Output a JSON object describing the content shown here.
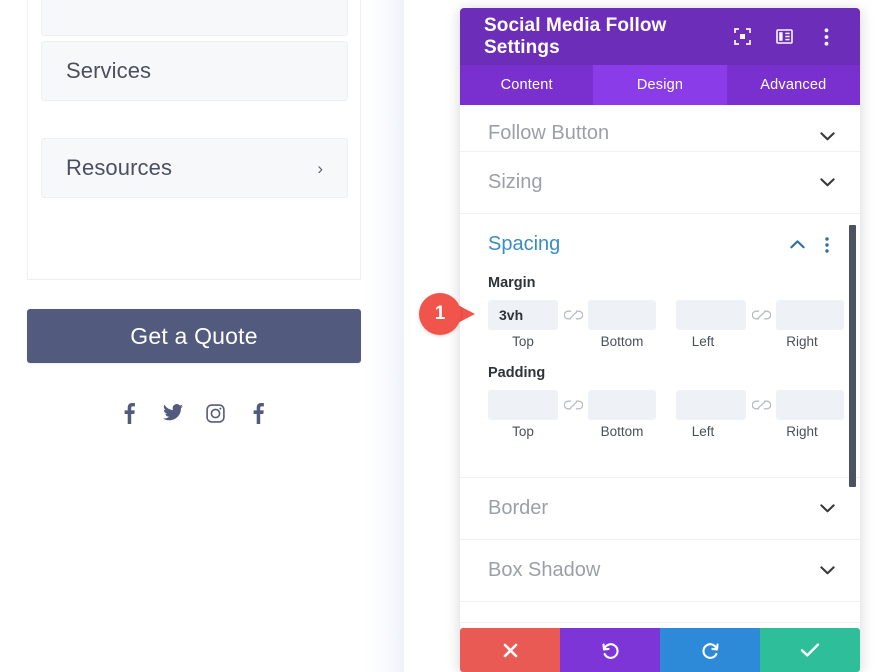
{
  "preview": {
    "menu_items": [
      {
        "label": "",
        "has_chevron": false
      },
      {
        "label": "Services",
        "has_chevron": false
      },
      {
        "label": "Resources",
        "has_chevron": true,
        "chevron": "›"
      }
    ],
    "cta_button": {
      "label": "Get a Quote",
      "color": "#525b7e"
    },
    "social_icons": [
      {
        "name": "facebook-icon",
        "label": "Facebook"
      },
      {
        "name": "twitter-icon",
        "label": "Twitter"
      },
      {
        "name": "instagram-icon",
        "label": "Instagram"
      },
      {
        "name": "facebook-icon",
        "label": "Facebook"
      }
    ]
  },
  "modal": {
    "title": "Social Media Follow Settings",
    "header_color": "#6c2eb9",
    "header_icons": [
      {
        "name": "focus-target-icon"
      },
      {
        "name": "layout-columns-icon"
      },
      {
        "name": "more-vertical-icon"
      }
    ],
    "tabs": [
      {
        "label": "Content",
        "active": false
      },
      {
        "label": "Design",
        "active": true
      },
      {
        "label": "Advanced",
        "active": false
      }
    ],
    "tab_active_color": "#8a3ce8",
    "sections": [
      {
        "key": "follow_button",
        "title": "Follow Button",
        "open": false,
        "chevron": "down"
      },
      {
        "key": "sizing",
        "title": "Sizing",
        "open": false,
        "chevron": "down"
      },
      {
        "key": "spacing",
        "title": "Spacing",
        "open": true,
        "chevron": "up"
      },
      {
        "key": "border",
        "title": "Border",
        "open": false,
        "chevron": "down"
      },
      {
        "key": "box_shadow",
        "title": "Box Shadow",
        "open": false,
        "chevron": "down"
      }
    ],
    "spacing": {
      "accent_color": "#3a8dc4",
      "margin": {
        "group_label": "Margin",
        "fields": [
          {
            "caption": "Top",
            "value": "3vh",
            "placeholder": ""
          },
          {
            "caption": "Bottom",
            "value": "",
            "placeholder": ""
          },
          {
            "caption": "Left",
            "value": "",
            "placeholder": ""
          },
          {
            "caption": "Right",
            "value": "",
            "placeholder": ""
          }
        ],
        "link_icon": "broken-link-icon"
      },
      "padding": {
        "group_label": "Padding",
        "fields": [
          {
            "caption": "Top",
            "value": "",
            "placeholder": ""
          },
          {
            "caption": "Bottom",
            "value": "",
            "placeholder": ""
          },
          {
            "caption": "Left",
            "value": "",
            "placeholder": ""
          },
          {
            "caption": "Right",
            "value": "",
            "placeholder": ""
          }
        ],
        "link_icon": "broken-link-icon"
      }
    },
    "footer_buttons": [
      {
        "name": "cancel-button",
        "icon": "close-x-icon",
        "color": "#ea5a54"
      },
      {
        "name": "undo-button",
        "icon": "undo-arrow-icon",
        "color": "#7e35d8"
      },
      {
        "name": "redo-button",
        "icon": "redo-arrow-icon",
        "color": "#2d8ad8"
      },
      {
        "name": "save-button",
        "icon": "checkmark-icon",
        "color": "#2ebf9a"
      }
    ]
  },
  "annotations": {
    "markers": [
      {
        "number": "1",
        "color": "#f0544a",
        "points_at": "margin-top-field"
      }
    ]
  }
}
